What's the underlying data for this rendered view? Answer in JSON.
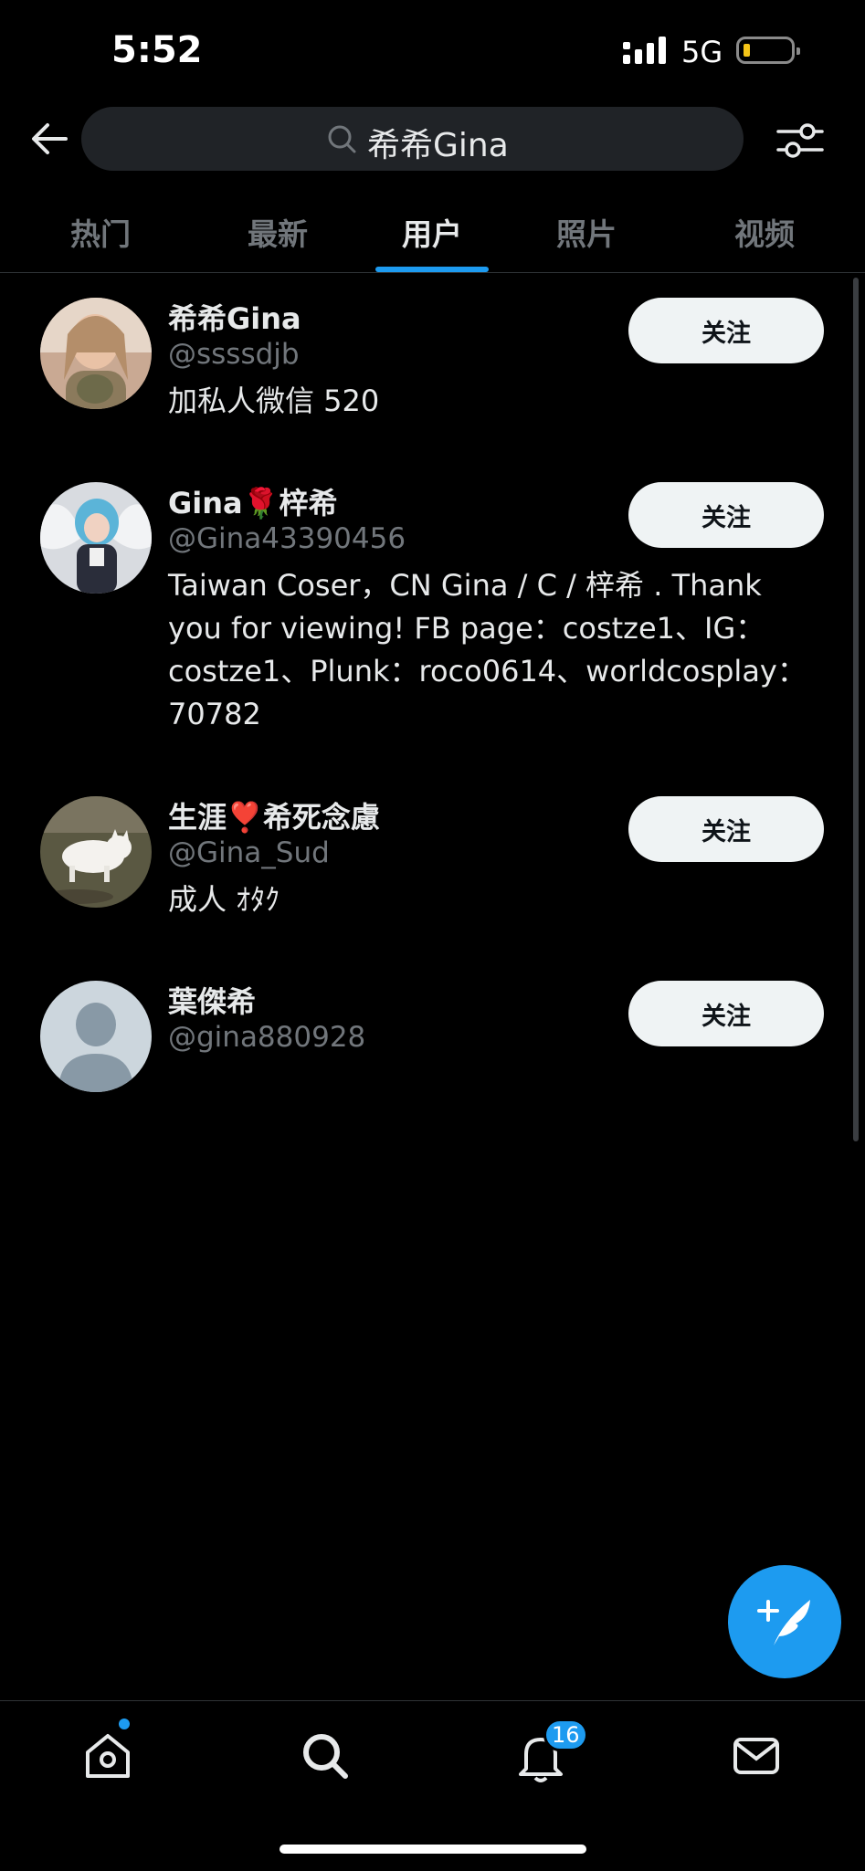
{
  "status": {
    "time": "5:52",
    "network": "5G",
    "battery_level": 0.08
  },
  "search": {
    "query": "希希Gina"
  },
  "tabs": [
    {
      "label": "热门"
    },
    {
      "label": "最新"
    },
    {
      "label": "用户"
    },
    {
      "label": "照片"
    },
    {
      "label": "视频"
    }
  ],
  "active_tab": "用户",
  "users": [
    {
      "name": "希希Gina",
      "handle": "@ssssdjb",
      "bio_lines": [
        "加私人微信 520"
      ],
      "follow_label": "关注"
    },
    {
      "name": "Gina🌹梓希",
      "handle": "@Gina43390456",
      "bio_lines": [
        "Taiwan Coser，CN Gina / C / 梓希 . Thank",
        "you for viewing! FB page：costze1、IG：",
        "costze1、Plunk：roco0614、worldcosplay：",
        "70782"
      ],
      "follow_label": "关注"
    },
    {
      "name": "生涯❣️希死念慮",
      "handle": "@Gina_Sud",
      "bio_lines": [
        "成人 ｵﾀｸ"
      ],
      "follow_label": "关注"
    },
    {
      "name": "葉傑希",
      "handle": "@gina880928",
      "bio_lines": [],
      "follow_label": "关注"
    }
  ],
  "nav": {
    "notifications_badge": "16"
  },
  "colors": {
    "accent": "#1d9bf0",
    "background": "#000000",
    "secondary_text": "#71767b"
  }
}
